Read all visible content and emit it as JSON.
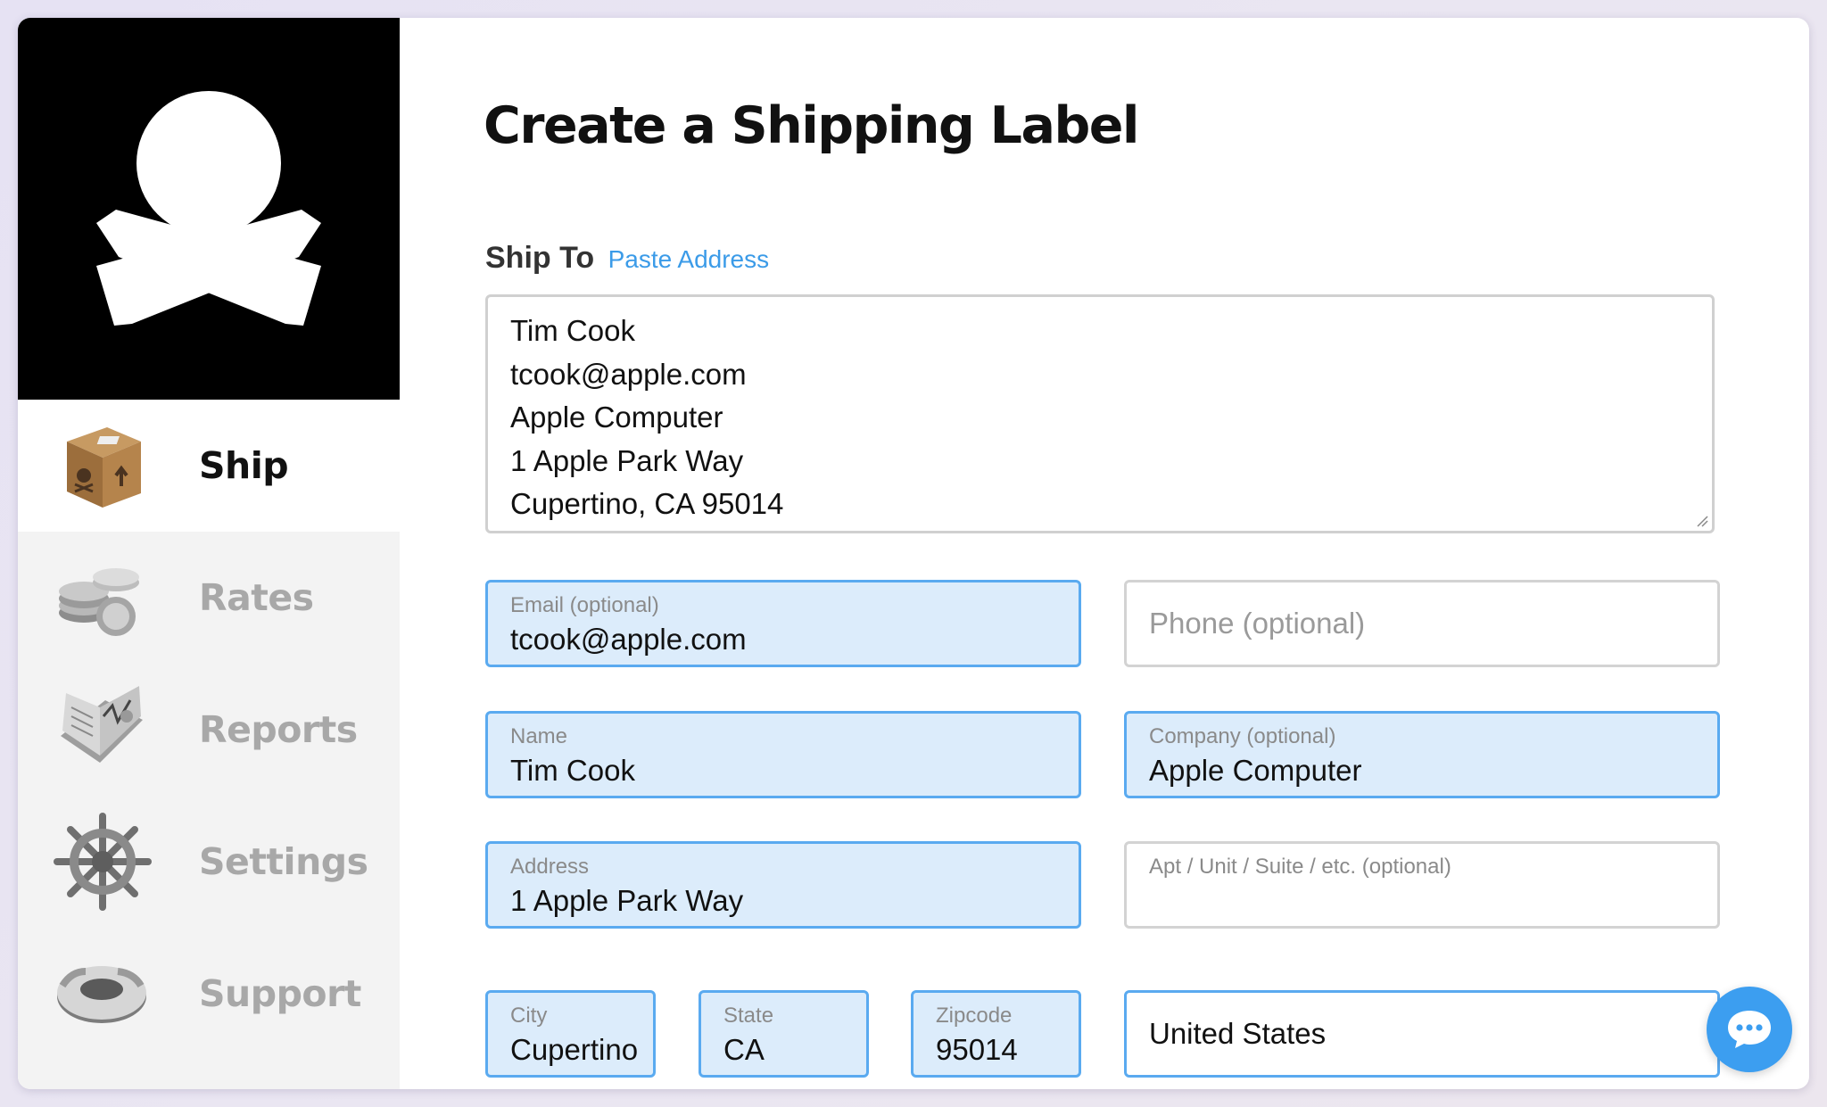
{
  "app": {
    "brand_colors": {
      "accent": "#3b9be8",
      "field_fill": "#dcecfb",
      "field_border": "#5aaaf0",
      "sidebar_bg": "#f3f3f3",
      "logo_bg": "#000000"
    }
  },
  "sidebar": {
    "logo_icon": "skull-crossbones-logo",
    "items": [
      {
        "label": "Ship",
        "icon": "cardboard-box-icon",
        "active": true
      },
      {
        "label": "Rates",
        "icon": "coins-icon",
        "active": false
      },
      {
        "label": "Reports",
        "icon": "open-book-icon",
        "active": false
      },
      {
        "label": "Settings",
        "icon": "ship-wheel-icon",
        "active": false
      },
      {
        "label": "Support",
        "icon": "life-ring-icon",
        "active": false
      }
    ]
  },
  "main": {
    "title": "Create a Shipping Label",
    "ship_to": {
      "label": "Ship To",
      "paste_link": "Paste Address",
      "address_lines": [
        "Tim Cook",
        "tcook@apple.com",
        "Apple Computer",
        "1 Apple Park Way",
        "Cupertino, CA 95014"
      ]
    },
    "fields": {
      "email": {
        "label": "Email (optional)",
        "value": "tcook@apple.com"
      },
      "phone": {
        "placeholder": "Phone (optional)"
      },
      "name": {
        "label": "Name",
        "value": "Tim Cook"
      },
      "company": {
        "label": "Company (optional)",
        "value": "Apple Computer"
      },
      "address": {
        "label": "Address",
        "value": "1 Apple Park Way"
      },
      "apt": {
        "label": "Apt / Unit / Suite / etc. (optional)",
        "value": ""
      },
      "city": {
        "label": "City",
        "value": "Cupertino"
      },
      "state": {
        "label": "State",
        "value": "CA"
      },
      "zip": {
        "label": "Zipcode",
        "value": "95014"
      },
      "country": {
        "value": "United States"
      }
    }
  },
  "chat": {
    "icon": "chat-bubble-icon"
  }
}
